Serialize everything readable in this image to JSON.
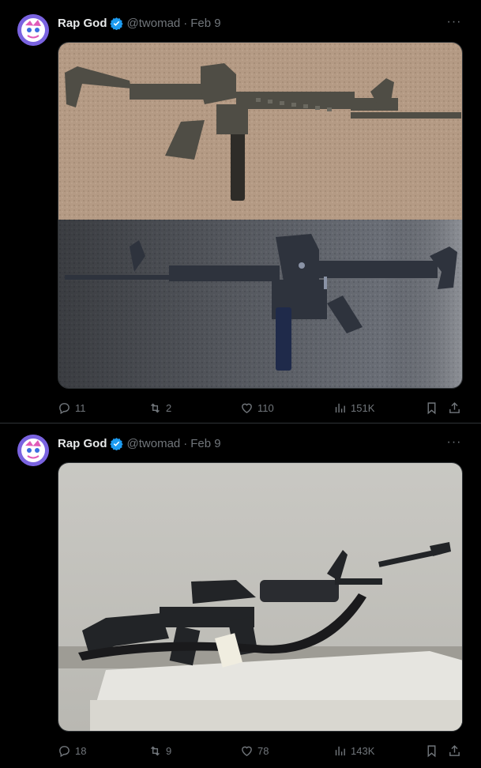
{
  "tweets": [
    {
      "author": {
        "name": "Rap God",
        "handle": "@twomad"
      },
      "dot": "·",
      "date": "Feb 9",
      "more": "···",
      "media": {
        "description_icon": "image-two-guns"
      },
      "stats": {
        "replies": "11",
        "retweets": "2",
        "likes": "110",
        "views": "151K"
      }
    },
    {
      "author": {
        "name": "Rap God",
        "handle": "@twomad"
      },
      "dot": "·",
      "date": "Feb 9",
      "more": "···",
      "media": {
        "description_icon": "image-rifle"
      },
      "stats": {
        "replies": "18",
        "retweets": "9",
        "likes": "78",
        "views": "143K"
      }
    }
  ],
  "colors": {
    "background": "#000000",
    "verified": "#1d9bf0",
    "muted": "#71767b",
    "text": "#e7e9ea"
  }
}
